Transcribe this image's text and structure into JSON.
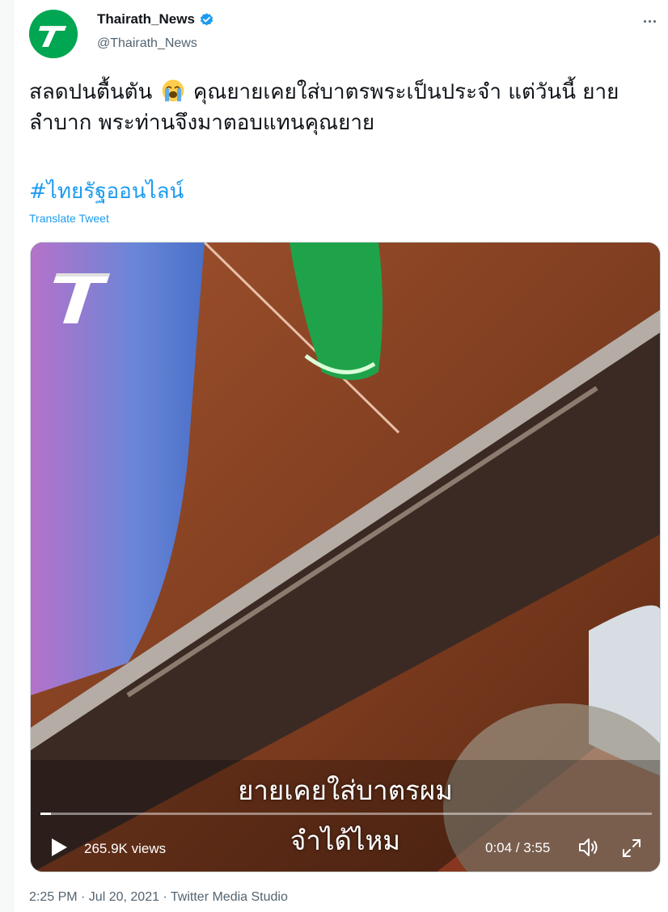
{
  "account": {
    "display_name": "Thairath_News",
    "handle": "@Thairath_News",
    "verified": true,
    "brand_color": "#00a651"
  },
  "tweet": {
    "text_part1": "สลดปนตื้นตัน",
    "emoji": "loudly-crying-face",
    "text_part2": "คุณยายเคยใส่บาตรพระเป็นประจำ แต่วันนี้ ยายลำบาก พระท่านจึงมาตอบแทนคุณยาย",
    "hashtag": "#ไทยรัฐออนไลน์",
    "translate_label": "Translate Tweet",
    "timestamp": "2:25 PM · Jul 20, 2021 · Twitter Media Studio"
  },
  "video": {
    "subtitle_line1": "ยายเคยใส่บาตรผม",
    "subtitle_line2": "จำได้ไหม",
    "views": "265.9K views",
    "time": "0:04 / 3:55",
    "progress_fraction": 0.017
  },
  "colors": {
    "accent": "#1d9bf0",
    "text": "#0f1419",
    "muted": "#536471"
  }
}
